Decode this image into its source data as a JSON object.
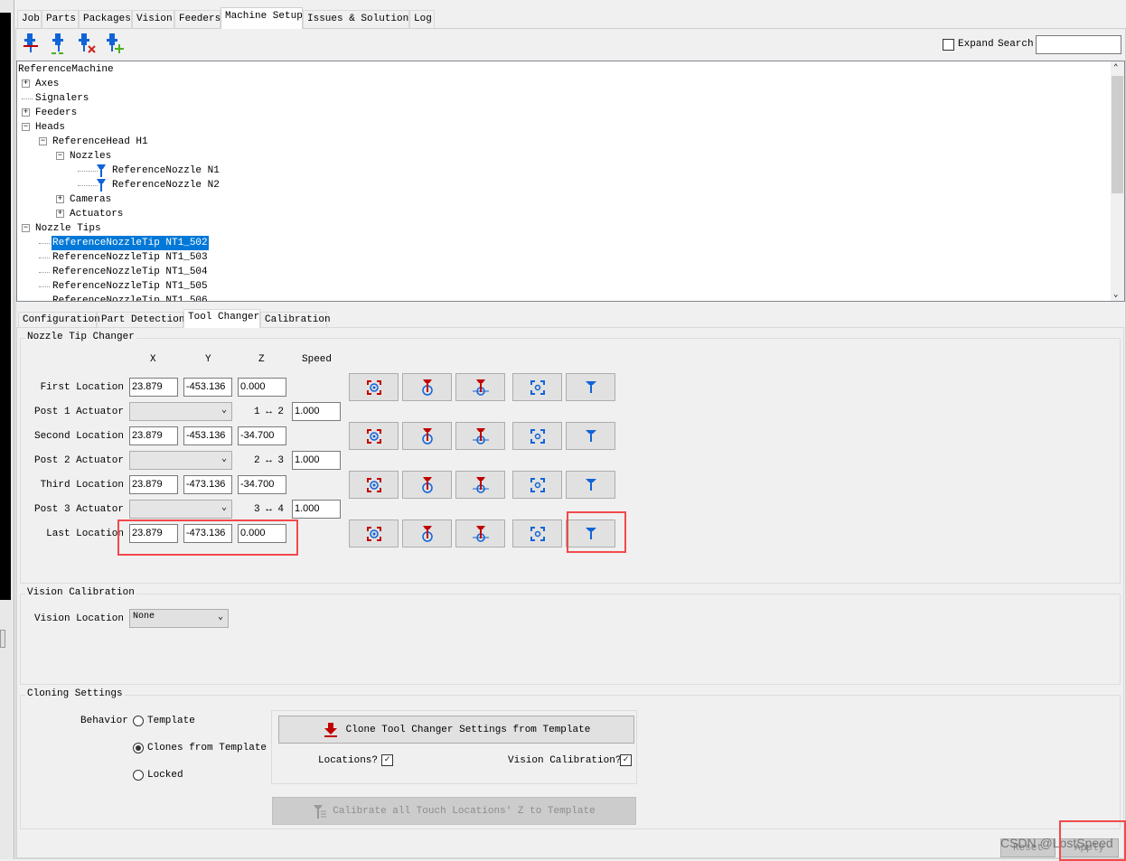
{
  "main_tabs": [
    "Job",
    "Parts",
    "Packages",
    "Vision",
    "Feeders",
    "Machine Setup",
    "Issues & Solutions",
    "Log"
  ],
  "active_main_tab": "Machine Setup",
  "toolbar": {
    "icons": [
      "nozzle-tip-icon",
      "nozzle-tip-load-icon",
      "nozzle-tip-remove-icon",
      "nozzle-tip-add-icon"
    ],
    "expand_label": "Expand",
    "search_label": "Search",
    "search_value": ""
  },
  "tree": {
    "root": "ReferenceMachine",
    "items": [
      "Axes",
      "Signalers",
      "Feeders",
      "Heads",
      "ReferenceHead H1",
      "Nozzles",
      "ReferenceNozzle N1",
      "ReferenceNozzle N2",
      "Cameras",
      "Actuators",
      "Nozzle Tips",
      "ReferenceNozzleTip NT1_502",
      "ReferenceNozzleTip NT1_503",
      "ReferenceNozzleTip NT1_504",
      "ReferenceNozzleTip NT1_505",
      "ReferenceNozzleTip NT1_506"
    ],
    "selected": "ReferenceNozzleTip NT1_502"
  },
  "sub_tabs": [
    "Configuration",
    "Part Detection",
    "Tool Changer",
    "Calibration"
  ],
  "active_sub_tab": "Tool Changer",
  "nozzle_tip_changer": {
    "title": "Nozzle Tip Changer",
    "headers": {
      "x": "X",
      "y": "Y",
      "z": "Z",
      "speed": "Speed"
    },
    "locations": [
      {
        "label": "First Location",
        "x": "23.879",
        "y": "-453.136",
        "z": "0.000"
      },
      {
        "label": "Second Location",
        "x": "23.879",
        "y": "-453.136",
        "z": "-34.700"
      },
      {
        "label": "Third Location",
        "x": "23.879",
        "y": "-473.136",
        "z": "-34.700"
      },
      {
        "label": "Last Location",
        "x": "23.879",
        "y": "-473.136",
        "z": "0.000"
      }
    ],
    "actuators": [
      {
        "label": "Post 1 Actuator",
        "value": "",
        "speed_label": "1 ↔ 2",
        "speed": "1.000"
      },
      {
        "label": "Post 2 Actuator",
        "value": "",
        "speed_label": "2 ↔ 3",
        "speed": "1.000"
      },
      {
        "label": "Post 3 Actuator",
        "value": "",
        "speed_label": "3 ↔ 4",
        "speed": "1.000"
      }
    ],
    "row_buttons": [
      "capture-camera-location-icon",
      "capture-tool-location-icon",
      "capture-tool-z-icon",
      "position-camera-icon",
      "position-tool-icon"
    ]
  },
  "vision_calibration": {
    "title": "Vision Calibration",
    "label": "Vision Location",
    "value": "None"
  },
  "cloning": {
    "title": "Cloning Settings",
    "behavior_label": "Behavior",
    "options": [
      "Template",
      "Clones from Template",
      "Locked"
    ],
    "selected": "Clones from Template",
    "clone_button": "Clone Tool Changer Settings from Template",
    "locations_label": "Locations?",
    "locations_checked": true,
    "vision_label": "Vision Calibration?",
    "vision_checked": true,
    "calibrate_button": "Calibrate all Touch Locations' Z to Template"
  },
  "footer": {
    "reset": "Reset",
    "apply": "Apply"
  },
  "watermark": "CSDN @LostSpeed",
  "colors": {
    "accent": "#0078d7",
    "icon_blue": "#1064d8",
    "icon_red": "#c00000",
    "highlight": "#f2494b"
  }
}
